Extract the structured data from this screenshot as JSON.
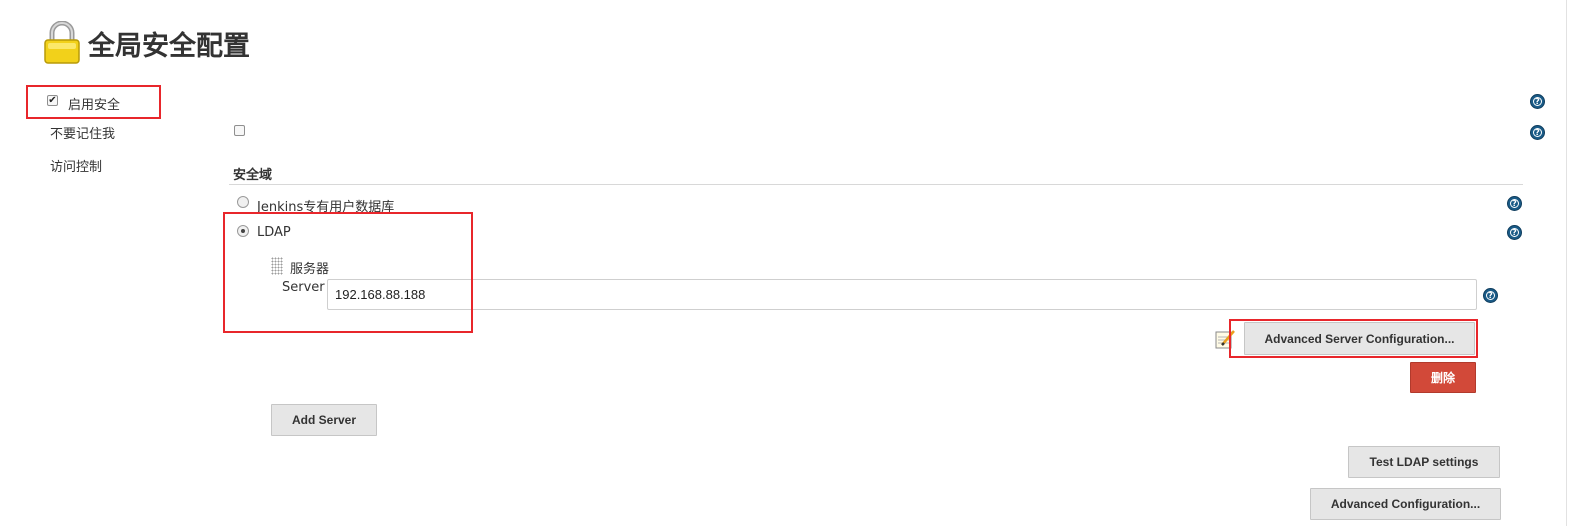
{
  "page": {
    "title": "全局安全配置"
  },
  "security": {
    "enable_security_label": "启用安全",
    "enable_security_checked": true,
    "dont_remember_me_label": "不要记住我",
    "dont_remember_me_checked": false,
    "access_control_label": "访问控制"
  },
  "realm": {
    "heading": "安全域",
    "options": [
      {
        "label": "Jenkins专有用户数据库",
        "selected": false
      },
      {
        "label": "LDAP",
        "selected": true
      }
    ]
  },
  "ldap": {
    "server_block_title": "服务器",
    "server_label": "Server",
    "server_value": "192.168.88.188",
    "advanced_server_button": "Advanced Server Configuration...",
    "delete_button": "删除",
    "add_server_button": "Add Server",
    "test_button": "Test LDAP settings",
    "advanced_button": "Advanced Configuration..."
  },
  "icons": {
    "help": "help-icon",
    "lock": "lock-icon",
    "notepad": "notepad-icon",
    "grip": "drag-handle-icon",
    "help_glyph": "?"
  },
  "colors": {
    "help_blue": "#1a5b87",
    "danger_red": "#d24939",
    "highlight_red": "#e8262b"
  }
}
